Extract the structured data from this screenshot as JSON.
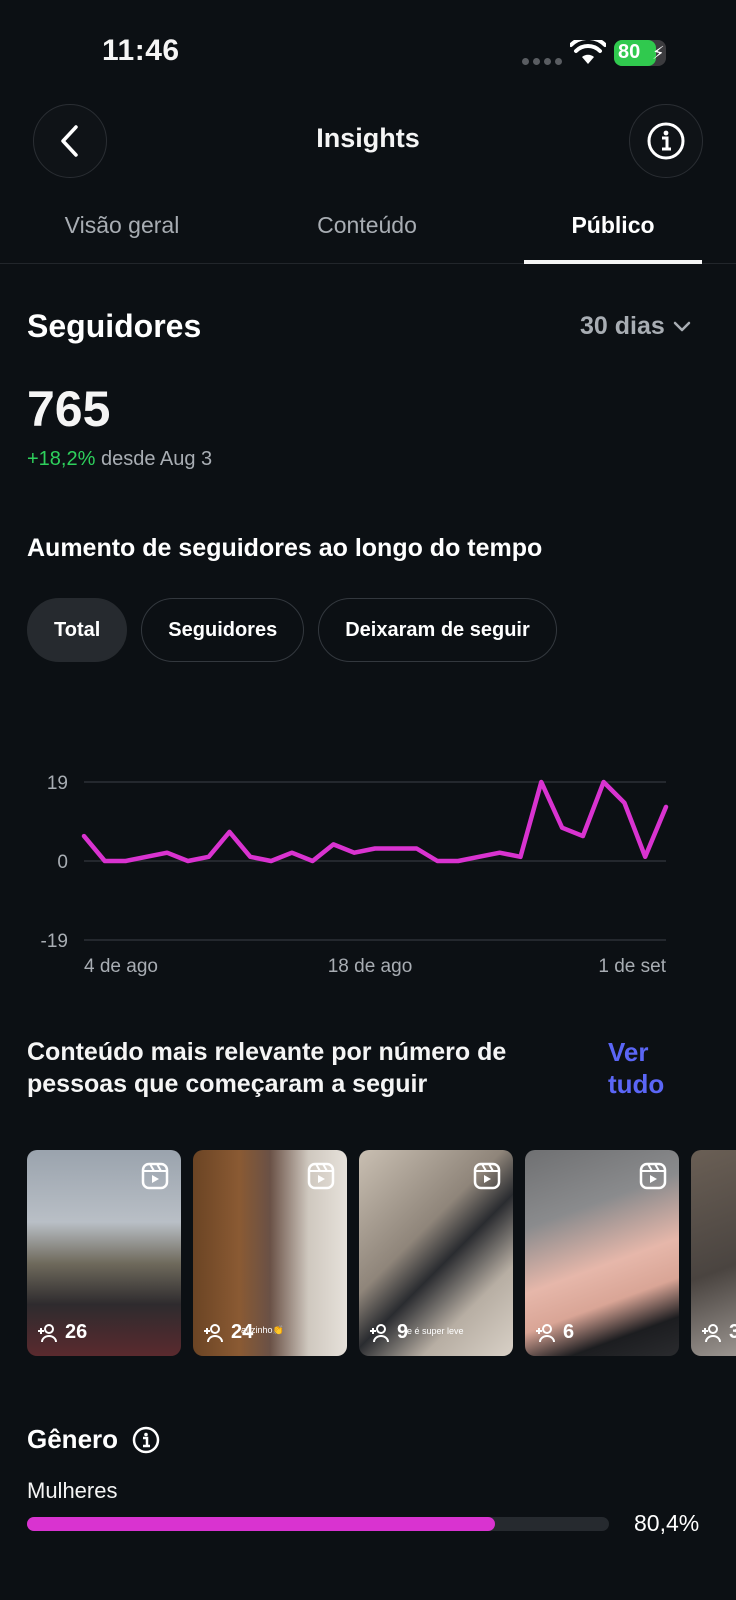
{
  "status": {
    "time": "11:46",
    "battery": "80"
  },
  "header": {
    "title": "Insights"
  },
  "tabs": [
    {
      "label": "Visão geral"
    },
    {
      "label": "Conteúdo"
    },
    {
      "label": "Público",
      "active": true
    }
  ],
  "followers": {
    "title": "Seguidores",
    "period": "30 dias",
    "count": "765",
    "change_pct": "+18,2%",
    "change_text": "desde Aug 3"
  },
  "growth": {
    "title": "Aumento de seguidores ao longo do tempo",
    "chips": [
      {
        "label": "Total",
        "active": true
      },
      {
        "label": "Seguidores"
      },
      {
        "label": "Deixaram de seguir"
      }
    ]
  },
  "chart_data": {
    "type": "line",
    "x_ticks": [
      "4 de ago",
      "18 de ago",
      "1 de set"
    ],
    "y_ticks": [
      19,
      0,
      -19
    ],
    "ylim": [
      -19,
      19
    ],
    "series": [
      {
        "color": "#d933d0",
        "values": [
          6,
          0,
          0,
          1,
          2,
          0,
          1,
          7,
          1,
          0,
          2,
          0,
          4,
          2,
          3,
          3,
          3,
          0,
          0,
          1,
          2,
          1,
          19,
          8,
          6,
          19,
          14,
          1,
          13
        ]
      }
    ],
    "grid": true
  },
  "relevant": {
    "title": "Conteúdo mais relevante por número de pessoas que começaram a seguir",
    "see_all": "Ver tudo",
    "items": [
      {
        "count": "26",
        "icon": "reels-icon"
      },
      {
        "count": "24",
        "caption": "auzinho👏",
        "icon": "reels-icon"
      },
      {
        "count": "9",
        "caption": "e é super leve",
        "icon": "reels-icon"
      },
      {
        "count": "6",
        "icon": "reels-icon"
      },
      {
        "count": "3"
      }
    ]
  },
  "gender": {
    "title": "Gênero",
    "women_label": "Mulheres",
    "women_pct": "80,4%",
    "women_fraction": 0.804,
    "bar_color": "#d933d0"
  },
  "colors": {
    "accent": "#5b66f6",
    "positive": "#2ed05c",
    "chart": "#d933d0"
  }
}
